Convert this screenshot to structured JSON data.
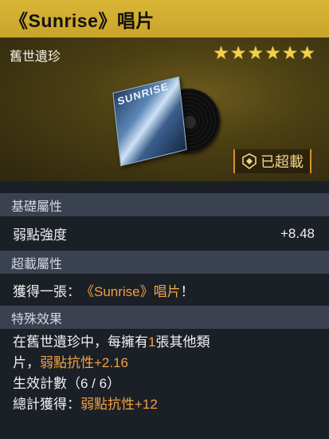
{
  "header": {
    "title": "《Sunrise》唱片"
  },
  "hero": {
    "category": "舊世遺珍",
    "stars_text": "★★★★★★",
    "rating": 6,
    "record_art_text": "SUNRISE",
    "overload_label": "已超載",
    "icon": "overload-badge-icon"
  },
  "sections": {
    "base_attr": {
      "title": "基礎屬性",
      "stat_name": "弱點強度",
      "stat_value": "+8.48"
    },
    "overload_attr": {
      "title": "超載屬性",
      "text_prefix": "獲得一張：",
      "text_item": "《Sunrise》唱片",
      "text_suffix": "！"
    },
    "special": {
      "title": "特殊效果",
      "line1_a": "在舊世遺珍中，每擁有",
      "line1_num": "1",
      "line1_b": "張其他類",
      "line2_a": "片，",
      "line2_b": "弱點抗性+2.16",
      "line3": "生效計數（6 / 6）",
      "line4_a": "總計獲得：",
      "line4_b": "弱點抗性+12"
    }
  },
  "colors": {
    "header_gold": "#d9b636",
    "accent_orange": "#f0a242",
    "section_bg": "#3a4150"
  }
}
